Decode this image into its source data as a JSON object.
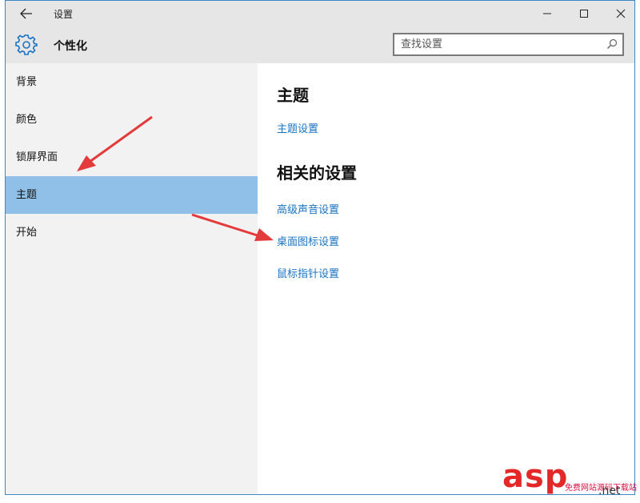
{
  "window": {
    "title": "设置",
    "back_icon": "arrow-left-icon"
  },
  "header": {
    "title": "个性化",
    "icon": "gear-icon",
    "accent": "#1a73c4"
  },
  "search": {
    "placeholder": "查找设置",
    "icon": "search-icon"
  },
  "sidebar": {
    "items": [
      {
        "label": "背景",
        "active": false
      },
      {
        "label": "颜色",
        "active": false
      },
      {
        "label": "锁屏界面",
        "active": false
      },
      {
        "label": "主题",
        "active": true
      },
      {
        "label": "开始",
        "active": false
      }
    ],
    "active_color": "#90c0e7"
  },
  "main": {
    "section1_title": "主题",
    "section1_links": [
      "主题设置"
    ],
    "section2_title": "相关的设置",
    "section2_links": [
      "高级声音设置",
      "桌面图标设置",
      "鼠标指针设置"
    ]
  },
  "watermark": {
    "brand": "asp",
    "sub": "免费网站源码下载站",
    "suffix": ".net"
  },
  "colors": {
    "link": "#1a73c4",
    "arrow": "#e33b3b",
    "titlebar": "#e6e6e6",
    "sidebar": "#f2f2f2"
  }
}
